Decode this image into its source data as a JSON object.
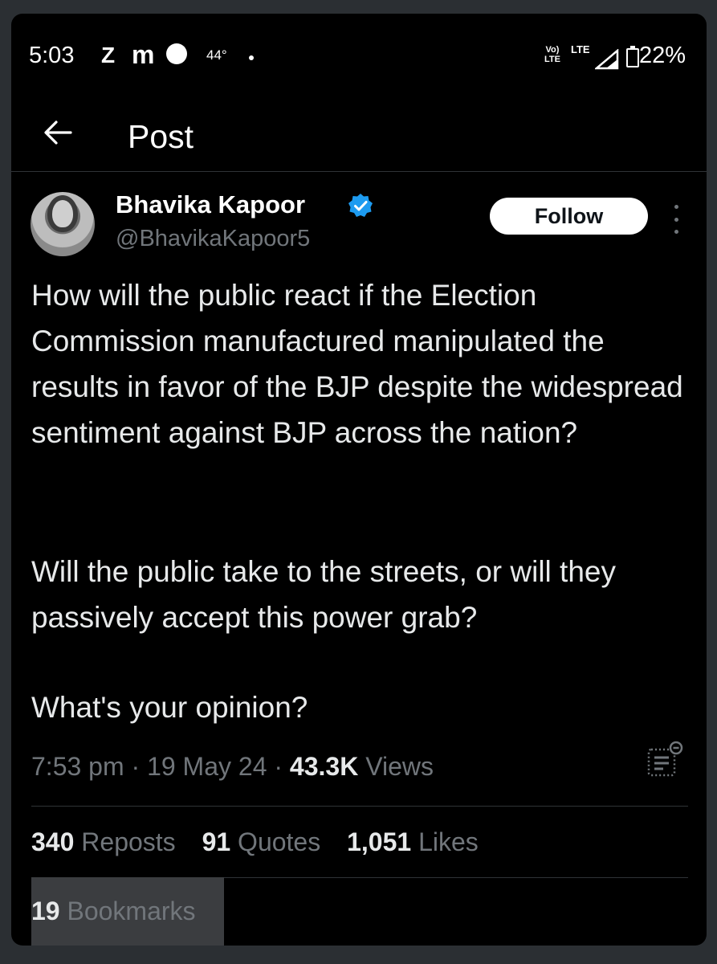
{
  "status_bar": {
    "time": "5:03",
    "notif_z": "Z",
    "notif_m": "m",
    "temp": "44°",
    "volte": "Vo\nLTE",
    "lte": "LTE",
    "battery": "22%",
    "battery_icon": "battery-icon",
    "signal_icon": "signal-icon"
  },
  "header": {
    "title": "Post",
    "back_icon": "arrow-left-icon"
  },
  "post": {
    "author_name": "Bhavika Kapoor",
    "author_handle": "@BhavikaKapoor5",
    "verified_icon": "verified-badge-icon",
    "follow_label": "Follow",
    "paragraphs": [
      "How will the public react if the Election Commission manufactured manipulated the results in favor of the BJP despite the widespread sentiment against BJP across the nation?",
      "Will the public take to the streets, or will they passively accept this power grab?",
      "What's your opinion?"
    ],
    "time": "7:53 pm",
    "date": "19 May 24",
    "views_count": "43.3K",
    "views_label": "Views",
    "analytics_icon": "post-analytics-icon"
  },
  "stats": {
    "reposts_count": "340",
    "reposts_label": "Reposts",
    "quotes_count": "91",
    "quotes_label": "Quotes",
    "likes_count": "1,051",
    "likes_label": "Likes",
    "bookmarks_count": "19",
    "bookmarks_label": "Bookmarks"
  },
  "colors": {
    "background": "#000000",
    "text": "#e7e9ea",
    "muted": "#71767b",
    "verified": "#1d9bf0"
  }
}
